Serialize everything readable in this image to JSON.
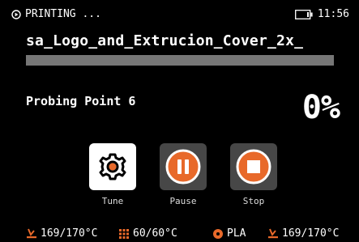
{
  "status": {
    "state_label": "PRINTING ...",
    "time": "11:56"
  },
  "job": {
    "filename": "sa_Logo_and_Extrucion_Cover_2x_",
    "progress_fraction": 0,
    "stage": "Probing Point 6",
    "percent": "0%"
  },
  "buttons": {
    "tune": "Tune",
    "pause": "Pause",
    "stop": "Stop"
  },
  "footer": {
    "nozzle1": "169/170°C",
    "bed": "60/60°C",
    "filament": "PLA",
    "nozzle2": "169/170°C"
  },
  "colors": {
    "accent": "#e8692a",
    "progress_track": "#767676",
    "button_dark": "#474747"
  }
}
